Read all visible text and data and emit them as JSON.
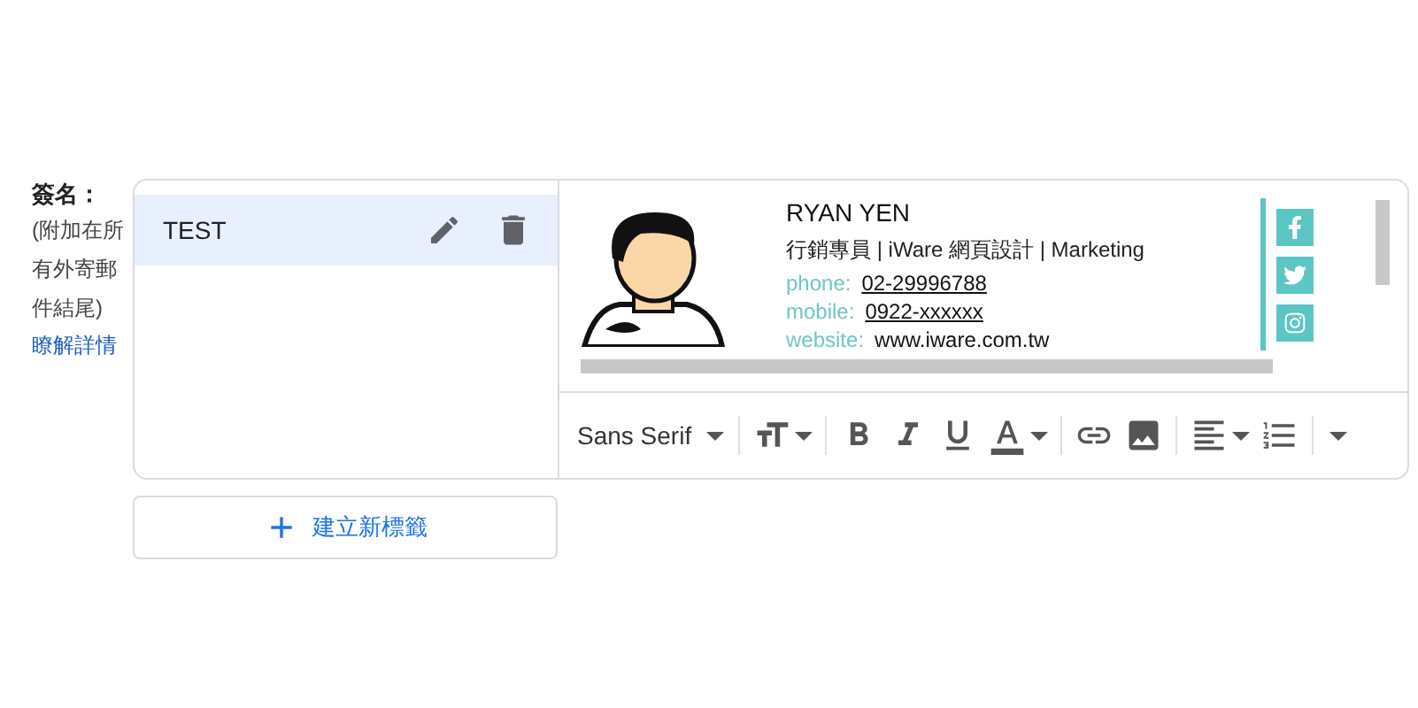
{
  "label": "簽名：",
  "note": "(附加在所有外寄郵件結尾)",
  "learn_more": "瞭解詳情",
  "signatures": [
    {
      "name": "TEST",
      "selected": true
    }
  ],
  "preview": {
    "name": "RYAN YEN",
    "title": "行銷專員 | iWare 網頁設計 | Marketing",
    "contacts": [
      {
        "label": "phone:",
        "value": "02-29996788",
        "underlined": true
      },
      {
        "label": "mobile:",
        "value": "0922-xxxxxx",
        "underlined": true
      },
      {
        "label": "website:",
        "value": "www.iware.com.tw",
        "underlined": false
      }
    ],
    "social": [
      {
        "kind": "facebook"
      },
      {
        "kind": "twitter"
      },
      {
        "kind": "instagram"
      }
    ]
  },
  "toolbar": {
    "font": "Sans Serif",
    "tools": [
      {
        "kind": "divider"
      },
      {
        "kind": "size"
      },
      {
        "kind": "divider"
      },
      {
        "kind": "bold"
      },
      {
        "kind": "italic"
      },
      {
        "kind": "underline"
      },
      {
        "kind": "color"
      },
      {
        "kind": "divider"
      },
      {
        "kind": "link"
      },
      {
        "kind": "image"
      },
      {
        "kind": "divider"
      },
      {
        "kind": "align"
      },
      {
        "kind": "numbered"
      },
      {
        "kind": "divider"
      },
      {
        "kind": "more"
      }
    ]
  },
  "new_button": "建立新標籤"
}
